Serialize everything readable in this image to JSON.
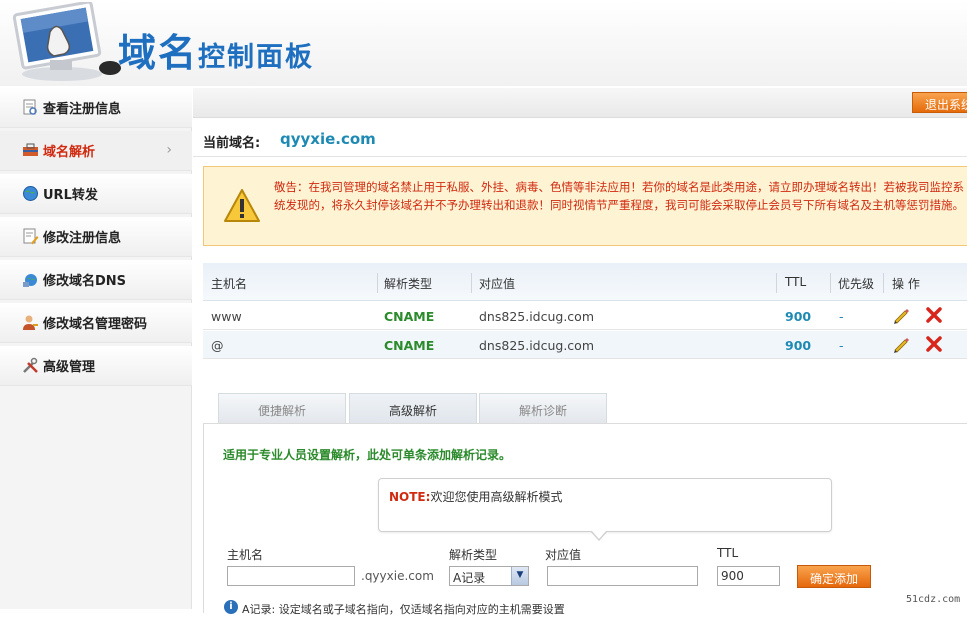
{
  "header": {
    "title_main": "域名",
    "title_sub": "控制面板"
  },
  "sidebar": {
    "items": [
      {
        "label": "查看注册信息",
        "icon": "document-view-icon"
      },
      {
        "label": "域名解析",
        "icon": "toolbox-icon",
        "active": true
      },
      {
        "label": "URL转发",
        "icon": "globe-icon"
      },
      {
        "label": "修改注册信息",
        "icon": "document-edit-icon"
      },
      {
        "label": "修改域名DNS",
        "icon": "network-globe-icon"
      },
      {
        "label": "修改域名管理密码",
        "icon": "user-key-icon"
      },
      {
        "label": "高级管理",
        "icon": "tools-icon"
      }
    ]
  },
  "topbar": {
    "logout_label": "退出系统"
  },
  "current_domain": {
    "label": "当前域名:",
    "value": "qyyxie.com"
  },
  "notice": {
    "text": "敬告：在我司管理的域名禁止用于私服、外挂、病毒、色情等非法应用！若你的域名是此类用途，请立即办理域名转出！若被我司监控系统发现的，将永久封停该域名并不予办理转出和退款！同时视情节严重程度，我司可能会采取停止会员号下所有域名及主机等惩罚措施。"
  },
  "records_table": {
    "headers": {
      "host": "主机名",
      "type": "解析类型",
      "value": "对应值",
      "ttl": "TTL",
      "priority": "优先级",
      "actions": "操 作"
    },
    "rows": [
      {
        "host": "www",
        "type": "CNAME",
        "value": "dns825.idcug.com",
        "ttl": "900",
        "priority": "-"
      },
      {
        "host": "@",
        "type": "CNAME",
        "value": "dns825.idcug.com",
        "ttl": "900",
        "priority": "-"
      }
    ]
  },
  "tabs": [
    {
      "label": "便捷解析"
    },
    {
      "label": "高级解析",
      "active": true
    },
    {
      "label": "解析诊断"
    }
  ],
  "panel": {
    "intro": "适用于专业人员设置解析，此处可单条添加解析记录。",
    "note_label": "NOTE:",
    "note_text": "欢迎您使用高级解析模式"
  },
  "form": {
    "host_label": "主机名",
    "host_value": "",
    "domain_suffix": ".qyyxie.com",
    "type_label": "解析类型",
    "type_value": "A记录",
    "value_label": "对应值",
    "value_value": "",
    "ttl_label": "TTL",
    "ttl_value": "900",
    "submit_label": "确定添加"
  },
  "bottom_hint": "A记录: 设定域名或子域名指向，仅适域名指向对应的主机需要设置",
  "watermark": "51cdz.com",
  "colors": {
    "accent_orange": "#e5670a",
    "link_blue": "#1e8ab3",
    "warning_red": "#d02a10",
    "type_green": "#2b8a2b"
  }
}
